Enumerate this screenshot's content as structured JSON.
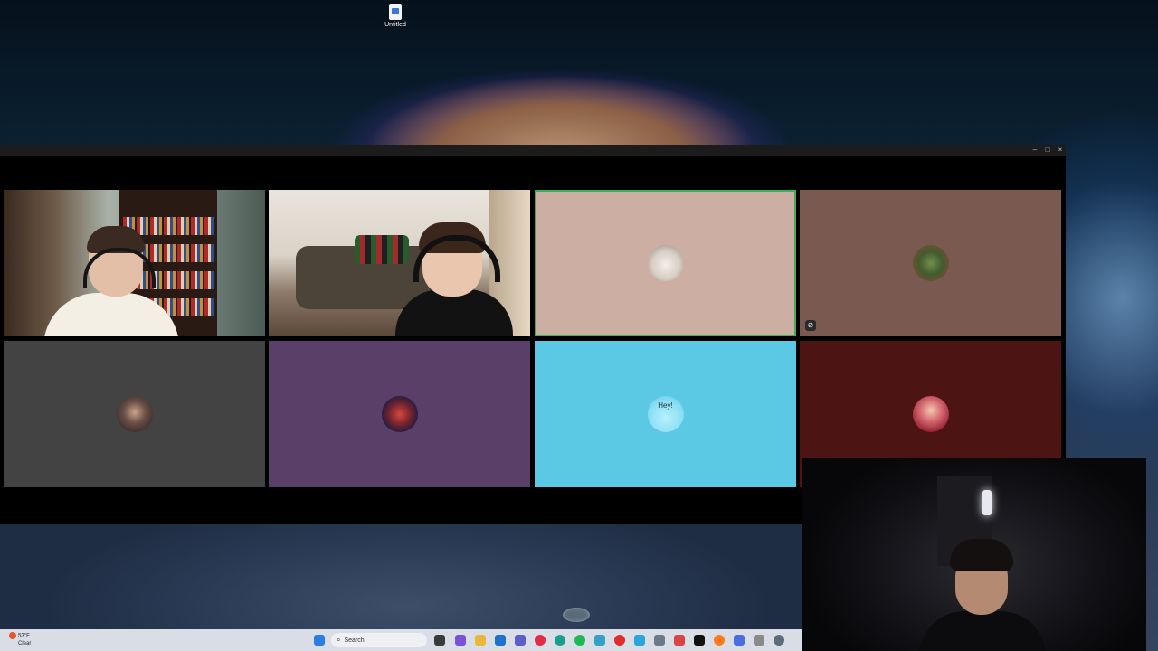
{
  "desktop": {
    "icon_label": "Untitled"
  },
  "meeting": {
    "tiles": [
      {
        "kind": "camera",
        "bg": "#5c6a62"
      },
      {
        "kind": "camera",
        "bg": "#8d7a69"
      },
      {
        "kind": "avatar",
        "bg": "#ccafa2",
        "avatar": "cat-avatar-icon",
        "active_speaker": true
      },
      {
        "kind": "avatar",
        "bg": "#7a5a50",
        "avatar": "green-character-avatar-icon",
        "muted_icon": "mic-off-icon"
      },
      {
        "kind": "avatar",
        "bg": "#434343",
        "avatar": "couple-photo-avatar-icon"
      },
      {
        "kind": "avatar",
        "bg": "#5a3f69",
        "avatar": "logo-avatar-icon"
      },
      {
        "kind": "avatar",
        "bg": "#5bc8e4",
        "avatar": "hey-creature-avatar-icon",
        "avatar_text": "Hey!"
      },
      {
        "kind": "avatar",
        "bg": "#4d1414",
        "avatar": "pink-hair-character-avatar-icon"
      }
    ],
    "window_controls": [
      "–",
      "□",
      "×"
    ]
  },
  "taskbar": {
    "weather_temp": "53°F",
    "weather_desc": "Clear",
    "search_placeholder": "Search",
    "apps": [
      "windows-start-icon",
      "copilot-icon",
      "file-explorer-icon",
      "edge-icon",
      "teams-icon",
      "opera-icon",
      "chrome-icon",
      "spotify-icon",
      "store-icon",
      "mail-icon",
      "youtube-icon",
      "notepad-icon",
      "calculator-icon",
      "obs-icon",
      "terminal-icon",
      "firefox-icon",
      "discord-icon",
      "snipping-icon",
      "settings-icon",
      "steam-icon"
    ]
  }
}
